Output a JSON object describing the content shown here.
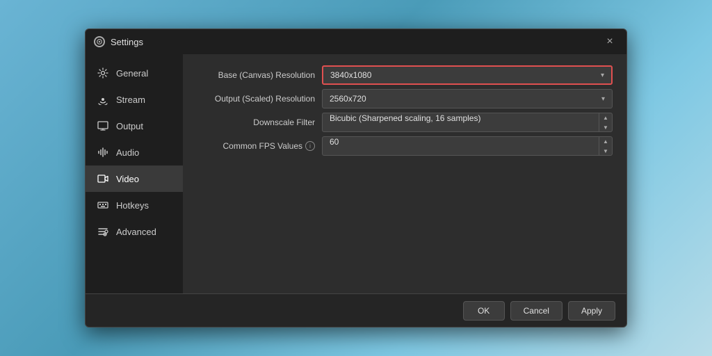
{
  "dialog": {
    "title": "Settings",
    "close_label": "×"
  },
  "sidebar": {
    "items": [
      {
        "id": "general",
        "label": "General",
        "active": false
      },
      {
        "id": "stream",
        "label": "Stream",
        "active": false
      },
      {
        "id": "output",
        "label": "Output",
        "active": false
      },
      {
        "id": "audio",
        "label": "Audio",
        "active": false
      },
      {
        "id": "video",
        "label": "Video",
        "active": true
      },
      {
        "id": "hotkeys",
        "label": "Hotkeys",
        "active": false
      },
      {
        "id": "advanced",
        "label": "Advanced",
        "active": false
      }
    ]
  },
  "video_settings": {
    "base_resolution_label": "Base (Canvas) Resolution",
    "base_resolution_value": "3840x1080",
    "output_resolution_label": "Output (Scaled) Resolution",
    "output_resolution_value": "2560x720",
    "downscale_filter_label": "Downscale Filter",
    "downscale_filter_value": "Bicubic (Sharpened scaling, 16 samples)",
    "fps_label": "Common FPS Values",
    "fps_value": "60"
  },
  "footer": {
    "ok_label": "OK",
    "cancel_label": "Cancel",
    "apply_label": "Apply"
  },
  "icons": {
    "gear": "⚙",
    "stream": "📶",
    "output": "🖥",
    "audio": "🔊",
    "video": "🖥",
    "hotkeys": "⌨",
    "advanced": "🔧",
    "close": "✕"
  }
}
